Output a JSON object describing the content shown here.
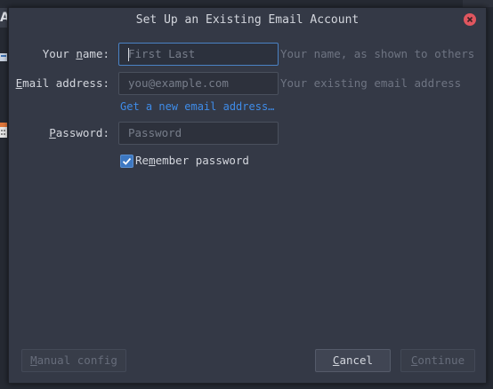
{
  "dialog": {
    "title": "Set Up an Existing Email Account"
  },
  "background_app": {
    "visible_letter": "A"
  },
  "form": {
    "name": {
      "label_pre": "Your ",
      "label_accel": "n",
      "label_post": "ame:",
      "placeholder": "First Last",
      "value": "",
      "hint": "Your name, as shown to others"
    },
    "email": {
      "label_accel": "E",
      "label_post": "mail address:",
      "placeholder": "you@example.com",
      "value": "",
      "hint": "Your existing email address"
    },
    "new_email_link": "Get a new email address…",
    "password": {
      "label_accel": "P",
      "label_post": "assword:",
      "placeholder": "Password",
      "value": ""
    },
    "remember": {
      "checked": true,
      "label_pre": "Re",
      "label_accel": "m",
      "label_post": "ember password"
    }
  },
  "buttons": {
    "manual": {
      "accel": "M",
      "rest": "anual config",
      "enabled": false
    },
    "cancel": {
      "pre": "",
      "accel": "C",
      "rest": "ancel",
      "enabled": true
    },
    "continue": {
      "accel": "C",
      "rest": "ontinue",
      "enabled": false
    }
  },
  "colors": {
    "dialog_bg": "#343946",
    "accent": "#3d78c2",
    "link": "#3f8ce8",
    "close": "#e0565f"
  }
}
